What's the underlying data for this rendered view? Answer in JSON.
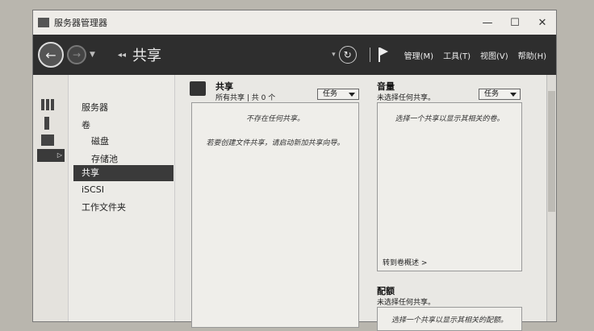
{
  "window": {
    "title": "服务器管理器",
    "minimize": "—",
    "maximize": "☐",
    "close": "✕"
  },
  "toolbar": {
    "back": "←",
    "forward": "→",
    "breadcrumb_prefix": "◂◂",
    "breadcrumb": "共享",
    "refresh": "↻",
    "menus": [
      "管理(M)",
      "工具(T)",
      "视图(V)",
      "帮助(H)"
    ]
  },
  "iconbar": {
    "active_arrow": "▷"
  },
  "nav": {
    "items": [
      {
        "label": "服务器"
      },
      {
        "label": "卷"
      },
      {
        "label": "磁盘"
      },
      {
        "label": "存储池"
      },
      {
        "label": "共享"
      },
      {
        "label": "iSCSI"
      },
      {
        "label": "工作文件夹"
      }
    ]
  },
  "shares": {
    "title": "共享",
    "subtitle": "所有共享 | 共 0 个",
    "task_label": "任务",
    "empty_msg": "不存在任何共享。",
    "hint_msg": "若要创建文件共享，请启动新加共享向导。"
  },
  "volume": {
    "title": "音量",
    "subtitle": "未选择任何共享。",
    "task_label": "任务",
    "msg": "选择一个共享以显示其相关的卷。",
    "link": "转到卷概述 >"
  },
  "quota": {
    "title": "配额",
    "subtitle": "未选择任何共享。",
    "msg": "选择一个共享以显示其相关的配额。"
  }
}
